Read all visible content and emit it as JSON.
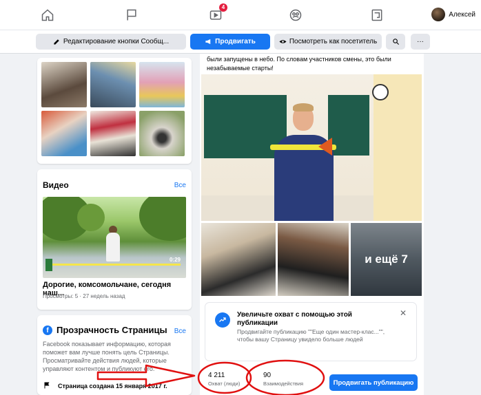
{
  "nav": {
    "icons": [
      "home-icon",
      "flag-icon",
      "video-icon",
      "groups-icon",
      "pages-icon"
    ],
    "video_badge": "4",
    "profile_name": "Алексей"
  },
  "actionbar": {
    "edit_button": "Редактирование кнопки Сообщ...",
    "promote_button": "Продвигать",
    "view_as_button": "Посмотреть как посетитель",
    "search_icon": "search-icon",
    "more_label": "···"
  },
  "video_card": {
    "title": "Видео",
    "see_all": "Все",
    "time": "0:29",
    "video_title": "Дорогие, комсомольчане, сегодня наш...",
    "video_meta": "Просмотры: 5 · 27 недель назад"
  },
  "transparency": {
    "title": "Прозрачность Страницы",
    "see_all": "Все",
    "body": "Facebook показывает информацию, которая поможет вам лучше понять цель Страницы. Просматривайте действия людей, которые управляют контентом и публикуют его.",
    "created": "Страница создана 15 января 2017 г."
  },
  "post": {
    "text": "были запущены в небо. По словам участников смены, это были незабываемые старты!",
    "more_photos": "и ещё 7"
  },
  "boost": {
    "title": "Увеличьте охват с помощью этой публикации",
    "text": "Продвигайте публикацию \"\"Еще один мастер-клас...\"\", чтобы вашу Страницу увидело больше людей",
    "close": "✕"
  },
  "stats": {
    "reach_value": "4 211",
    "reach_label": "Охват (люди)",
    "engagement_value": "90",
    "engagement_label": "Взаимодействия",
    "boost_button": "Продвигать публикацию"
  },
  "colors": {
    "accent": "#1877f2",
    "annotation_red": "#e01010"
  }
}
